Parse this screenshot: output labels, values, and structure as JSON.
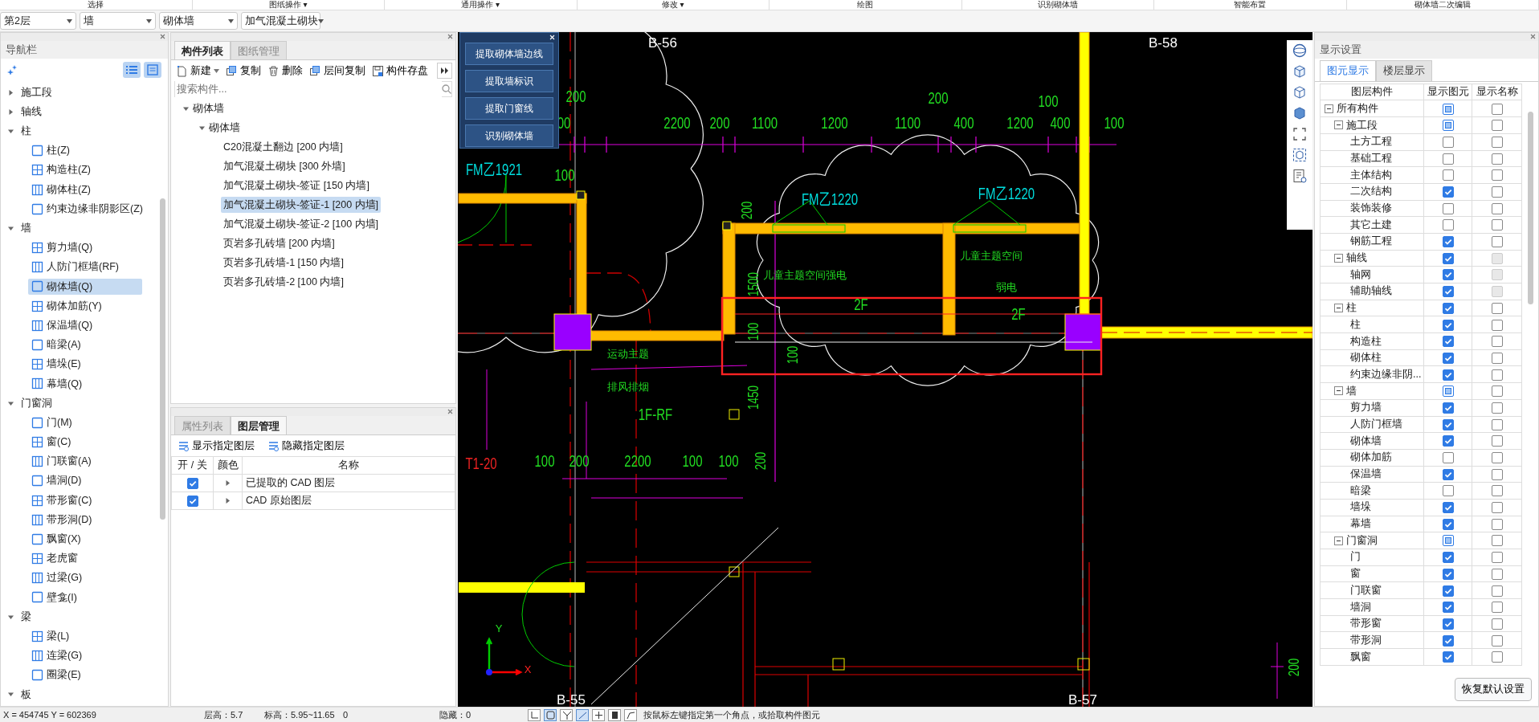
{
  "ribbon_groups": [
    "选择",
    "图纸操作 ▾",
    "通用操作 ▾",
    "修改 ▾",
    "绘图",
    "识别砌体墙",
    "智能布置",
    "砌体墙二次编辑"
  ],
  "selectors": [
    "第2层",
    "墙",
    "砌体墙",
    "加气混凝土砌块"
  ],
  "navigator": {
    "title": "导航栏",
    "groups": [
      {
        "label": "施工段",
        "expanded": false
      },
      {
        "label": "轴线",
        "expanded": false
      },
      {
        "label": "柱",
        "expanded": true,
        "children": [
          {
            "label": "柱(Z)",
            "selected": false
          },
          {
            "label": "构造柱(Z)",
            "selected": false
          },
          {
            "label": "砌体柱(Z)",
            "selected": false
          },
          {
            "label": "约束边缘非阴影区(Z)",
            "selected": false
          }
        ]
      },
      {
        "label": "墙",
        "expanded": true,
        "children": [
          {
            "label": "剪力墙(Q)",
            "selected": false
          },
          {
            "label": "人防门框墙(RF)",
            "selected": false
          },
          {
            "label": "砌体墙(Q)",
            "selected": true
          },
          {
            "label": "砌体加筋(Y)",
            "selected": false
          },
          {
            "label": "保温墙(Q)",
            "selected": false
          },
          {
            "label": "暗梁(A)",
            "selected": false
          },
          {
            "label": "墙垛(E)",
            "selected": false
          },
          {
            "label": "幕墙(Q)",
            "selected": false
          }
        ]
      },
      {
        "label": "门窗洞",
        "expanded": true,
        "children": [
          {
            "label": "门(M)",
            "selected": false
          },
          {
            "label": "窗(C)",
            "selected": false
          },
          {
            "label": "门联窗(A)",
            "selected": false
          },
          {
            "label": "墙洞(D)",
            "selected": false
          },
          {
            "label": "带形窗(C)",
            "selected": false
          },
          {
            "label": "带形洞(D)",
            "selected": false
          },
          {
            "label": "飘窗(X)",
            "selected": false
          },
          {
            "label": "老虎窗",
            "selected": false
          },
          {
            "label": "过梁(G)",
            "selected": false
          },
          {
            "label": "壁龛(I)",
            "selected": false
          }
        ]
      },
      {
        "label": "梁",
        "expanded": true,
        "children": [
          {
            "label": "梁(L)",
            "selected": false
          },
          {
            "label": "连梁(G)",
            "selected": false
          },
          {
            "label": "圈梁(E)",
            "selected": false
          }
        ]
      },
      {
        "label": "板",
        "expanded": true
      }
    ]
  },
  "component_panel": {
    "tabs": [
      {
        "label": "构件列表",
        "selected": true
      },
      {
        "label": "图纸管理",
        "selected": false
      }
    ],
    "toolbar": [
      "新建",
      "复制",
      "删除",
      "层间复制",
      "构件存盘"
    ],
    "search": {
      "placeholder": "搜索构件..."
    },
    "tree": [
      {
        "label": "砌体墙",
        "expanded": true,
        "children": [
          {
            "label": "砌体墙",
            "expanded": true,
            "children": [
              {
                "label": "C20混凝土翻边 [200 内墙]",
                "selected": false
              },
              {
                "label": "加气混凝土砌块 [300 外墙]",
                "selected": false
              },
              {
                "label": "加气混凝土砌块-签证 [150 内墙]",
                "selected": false
              },
              {
                "label": "加气混凝土砌块-签证-1 [200 内墙]",
                "selected": true
              },
              {
                "label": "加气混凝土砌块-签证-2 [100 内墙]",
                "selected": false
              },
              {
                "label": "页岩多孔砖墙 [200 内墙]",
                "selected": false
              },
              {
                "label": "页岩多孔砖墙-1 [150 内墙]",
                "selected": false
              },
              {
                "label": "页岩多孔砖墙-2 [100 内墙]",
                "selected": false
              }
            ]
          }
        ]
      }
    ]
  },
  "layer_panel": {
    "tabs": [
      {
        "label": "属性列表",
        "selected": false
      },
      {
        "label": "图层管理",
        "selected": true
      }
    ],
    "actions": [
      "显示指定图层",
      "隐藏指定图层"
    ],
    "columns": [
      "开 / 关",
      "颜色",
      "名称"
    ],
    "rows": [
      {
        "on": true,
        "name": "已提取的 CAD 图层"
      },
      {
        "on": true,
        "name": "CAD 原始图层"
      }
    ]
  },
  "recognize_panel": {
    "buttons": [
      "提取砌体墙边线",
      "提取墙标识",
      "提取门窗线",
      "识别砌体墙"
    ]
  },
  "canvas": {
    "labels": [
      {
        "kind": "axis",
        "text": "B-56"
      },
      {
        "kind": "axis",
        "text": "B-58"
      },
      {
        "kind": "dimension",
        "text": "200"
      },
      {
        "kind": "dimension",
        "text": "200"
      },
      {
        "kind": "dimension",
        "text": "100"
      },
      {
        "kind": "dimension",
        "text": "00"
      },
      {
        "kind": "dimension",
        "text": "2200"
      },
      {
        "kind": "dimension",
        "text": "200"
      },
      {
        "kind": "dimension",
        "text": "1100"
      },
      {
        "kind": "dimension",
        "text": "1200"
      },
      {
        "kind": "dimension",
        "text": "1100"
      },
      {
        "kind": "dimension",
        "text": "400"
      },
      {
        "kind": "dimension",
        "text": "1200"
      },
      {
        "kind": "dimension",
        "text": "400"
      },
      {
        "kind": "dimension",
        "text": "100"
      },
      {
        "kind": "dimension",
        "text": "100"
      },
      {
        "kind": "door",
        "text": "FM乙1921"
      },
      {
        "kind": "door",
        "text": "FM乙1220"
      },
      {
        "kind": "door",
        "text": "FM乙1220"
      },
      {
        "kind": "room",
        "text": "儿童主题空间强电"
      },
      {
        "kind": "room",
        "text": "儿童主题空间"
      },
      {
        "kind": "room",
        "text": "弱电"
      },
      {
        "kind": "dimension",
        "text": "2F"
      },
      {
        "kind": "dimension",
        "text": "2F"
      },
      {
        "kind": "vdimension",
        "text": "200"
      },
      {
        "kind": "vdimension",
        "text": "1500"
      },
      {
        "kind": "vdimension",
        "text": "100"
      },
      {
        "kind": "vdimension",
        "text": "100"
      },
      {
        "kind": "vdimension",
        "text": "1450"
      },
      {
        "kind": "room",
        "text": "运动主题"
      },
      {
        "kind": "room",
        "text": "排风排烟"
      },
      {
        "kind": "dimension",
        "text": "1F-RF"
      },
      {
        "kind": "sheet",
        "text": "T1-20"
      },
      {
        "kind": "dimension",
        "text": "100"
      },
      {
        "kind": "dimension",
        "text": "200"
      },
      {
        "kind": "dimension",
        "text": "2200"
      },
      {
        "kind": "dimension",
        "text": "100"
      },
      {
        "kind": "dimension",
        "text": "100"
      },
      {
        "kind": "vdimension",
        "text": "200"
      },
      {
        "kind": "axis",
        "text": "B-55"
      },
      {
        "kind": "axis",
        "text": "B-57"
      },
      {
        "kind": "vdimension",
        "text": "200"
      },
      {
        "kind": "ucsy",
        "text": "Y"
      },
      {
        "kind": "ucsx",
        "text": "X"
      }
    ]
  },
  "display_settings": {
    "title": "显示设置",
    "tabs": [
      {
        "label": "图元显示",
        "selected": true
      },
      {
        "label": "楼层显示",
        "selected": false
      }
    ],
    "columns": [
      "图层构件",
      "显示图元",
      "显示名称"
    ],
    "rows": [
      {
        "label": "所有构件",
        "expanded": true,
        "shown": true,
        "mixed": true,
        "show_name": false,
        "name_disabled": false,
        "children": [
          {
            "label": "施工段",
            "expanded": true,
            "shown": true,
            "mixed": true,
            "show_name": false,
            "name_disabled": false,
            "children": [
              {
                "label": "土方工程",
                "shown": false,
                "mixed": false,
                "show_name": false,
                "name_disabled": false
              },
              {
                "label": "基础工程",
                "shown": false,
                "mixed": false,
                "show_name": false,
                "name_disabled": false
              },
              {
                "label": "主体结构",
                "shown": false,
                "mixed": false,
                "show_name": false,
                "name_disabled": false
              },
              {
                "label": "二次结构",
                "shown": true,
                "mixed": false,
                "show_name": false,
                "name_disabled": false
              },
              {
                "label": "装饰装修",
                "shown": false,
                "mixed": false,
                "show_name": false,
                "name_disabled": false
              },
              {
                "label": "其它土建",
                "shown": false,
                "mixed": false,
                "show_name": false,
                "name_disabled": false
              },
              {
                "label": "钢筋工程",
                "shown": true,
                "mixed": false,
                "show_name": false,
                "name_disabled": false
              }
            ]
          },
          {
            "label": "轴线",
            "expanded": true,
            "shown": true,
            "mixed": false,
            "show_name": false,
            "name_disabled": true,
            "children": [
              {
                "label": "轴网",
                "shown": true,
                "mixed": false,
                "show_name": false,
                "name_disabled": true
              },
              {
                "label": "辅助轴线",
                "shown": true,
                "mixed": false,
                "show_name": false,
                "name_disabled": true
              }
            ]
          },
          {
            "label": "柱",
            "expanded": true,
            "shown": true,
            "mixed": false,
            "show_name": false,
            "name_disabled": false,
            "children": [
              {
                "label": "柱",
                "shown": true,
                "mixed": false,
                "show_name": false,
                "name_disabled": false
              },
              {
                "label": "构造柱",
                "shown": true,
                "mixed": false,
                "show_name": false,
                "name_disabled": false
              },
              {
                "label": "砌体柱",
                "shown": true,
                "mixed": false,
                "show_name": false,
                "name_disabled": false
              },
              {
                "label": "约束边缘非阴...",
                "shown": true,
                "mixed": false,
                "show_name": false,
                "name_disabled": false
              }
            ]
          },
          {
            "label": "墙",
            "expanded": true,
            "shown": true,
            "mixed": true,
            "show_name": false,
            "name_disabled": false,
            "children": [
              {
                "label": "剪力墙",
                "shown": true,
                "mixed": false,
                "show_name": false,
                "name_disabled": false
              },
              {
                "label": "人防门框墙",
                "shown": true,
                "mixed": false,
                "show_name": false,
                "name_disabled": false
              },
              {
                "label": "砌体墙",
                "shown": true,
                "mixed": false,
                "show_name": false,
                "name_disabled": false
              },
              {
                "label": "砌体加筋",
                "shown": false,
                "mixed": false,
                "show_name": false,
                "name_disabled": false
              },
              {
                "label": "保温墙",
                "shown": true,
                "mixed": false,
                "show_name": false,
                "name_disabled": false
              },
              {
                "label": "暗梁",
                "shown": false,
                "mixed": false,
                "show_name": false,
                "name_disabled": false
              },
              {
                "label": "墙垛",
                "shown": true,
                "mixed": false,
                "show_name": false,
                "name_disabled": false
              },
              {
                "label": "幕墙",
                "shown": true,
                "mixed": false,
                "show_name": false,
                "name_disabled": false
              }
            ]
          },
          {
            "label": "门窗洞",
            "expanded": true,
            "shown": true,
            "mixed": true,
            "show_name": false,
            "name_disabled": false,
            "children": [
              {
                "label": "门",
                "shown": true,
                "mixed": false,
                "show_name": false,
                "name_disabled": false
              },
              {
                "label": "窗",
                "shown": true,
                "mixed": false,
                "show_name": false,
                "name_disabled": false
              },
              {
                "label": "门联窗",
                "shown": true,
                "mixed": false,
                "show_name": false,
                "name_disabled": false
              },
              {
                "label": "墙洞",
                "shown": true,
                "mixed": false,
                "show_name": false,
                "name_disabled": false
              },
              {
                "label": "带形窗",
                "shown": true,
                "mixed": false,
                "show_name": false,
                "name_disabled": false
              },
              {
                "label": "带形洞",
                "shown": true,
                "mixed": false,
                "show_name": false,
                "name_disabled": false
              },
              {
                "label": "飘窗",
                "shown": true,
                "mixed": false,
                "show_name": false,
                "name_disabled": false
              }
            ]
          }
        ]
      }
    ],
    "reset_button": "恢复默认设置"
  },
  "status_bar": {
    "coordinates": "X = 454745 Y = 602369",
    "floor_height": "层高：5.7",
    "elevation": "标高：5.95~11.65",
    "value": "0",
    "hidden": "隐藏：0",
    "prompt": "按鼠标左键指定第一个角点，或拾取构件图元"
  }
}
